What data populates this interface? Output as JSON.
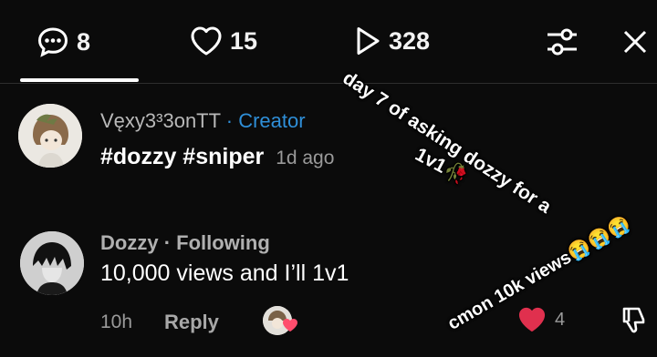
{
  "topbar": {
    "comments_count": "8",
    "likes_count": "15",
    "views_count": "328"
  },
  "creator_comment": {
    "username": "Vęxy3³3onTT",
    "tag": "· Creator",
    "text": "#dozzy #sniper",
    "time": "1d ago"
  },
  "reply_comment": {
    "username": "Dozzy",
    "tag": "· Following",
    "text": "10,000 views and I’ll 1v1",
    "time": "10h",
    "reply_label": "Reply",
    "like_count": "4"
  },
  "overlay": {
    "line1": "day 7 of asking dozzy for a",
    "line2": "1v1🥀",
    "line3": "cmon 10k views😭😭😭"
  },
  "colors": {
    "background": "#0b0b0b",
    "creator_tag": "#2f8fd8",
    "heart": "#e0304e"
  }
}
